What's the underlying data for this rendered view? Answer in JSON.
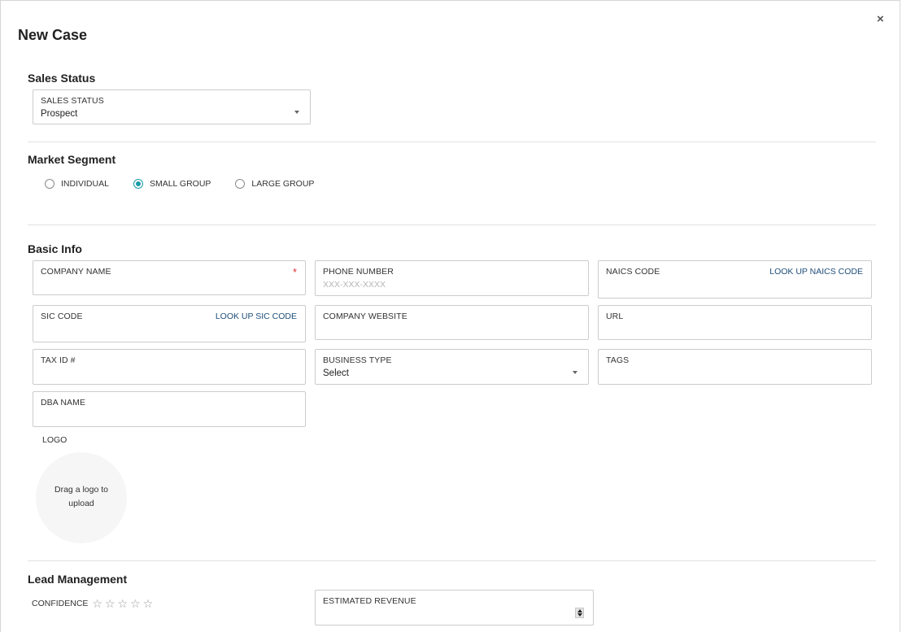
{
  "modal": {
    "title": "New Case",
    "close_glyph": "×"
  },
  "sales_status": {
    "section_title": "Sales Status",
    "label": "SALES STATUS",
    "value": "Prospect"
  },
  "market_segment": {
    "section_title": "Market Segment",
    "options": [
      {
        "label": "INDIVIDUAL",
        "selected": false
      },
      {
        "label": "SMALL GROUP",
        "selected": true
      },
      {
        "label": "LARGE GROUP",
        "selected": false
      }
    ]
  },
  "basic_info": {
    "section_title": "Basic Info",
    "company_name": {
      "label": "COMPANY NAME",
      "required_mark": "*"
    },
    "phone_number": {
      "label": "PHONE NUMBER",
      "placeholder": "XXX-XXX-XXXX"
    },
    "naics_code": {
      "label": "NAICS CODE",
      "link": "LOOK UP NAICS CODE"
    },
    "sic_code": {
      "label": "SIC CODE",
      "link": "LOOK UP SIC CODE"
    },
    "company_website": {
      "label": "COMPANY WEBSITE"
    },
    "url": {
      "label": "URL"
    },
    "tax_id": {
      "label": "TAX ID #"
    },
    "business_type": {
      "label": "BUSINESS TYPE",
      "value": "Select"
    },
    "tags": {
      "label": "TAGS"
    },
    "dba_name": {
      "label": "DBA NAME"
    },
    "logo": {
      "label": "LOGO",
      "drop_line1": "Drag a logo to",
      "drop_line2": "upload"
    }
  },
  "lead_management": {
    "section_title": "Lead Management",
    "confidence": {
      "label": "CONFIDENCE",
      "stars_total": 5,
      "stars_filled": 0,
      "star_glyph": "☆"
    },
    "estimated_revenue": {
      "label": "ESTIMATED REVENUE"
    }
  },
  "colors": {
    "accent": "#1a9aa8",
    "link": "#1f4e79",
    "required": "#e03131",
    "border": "#cccccc"
  }
}
